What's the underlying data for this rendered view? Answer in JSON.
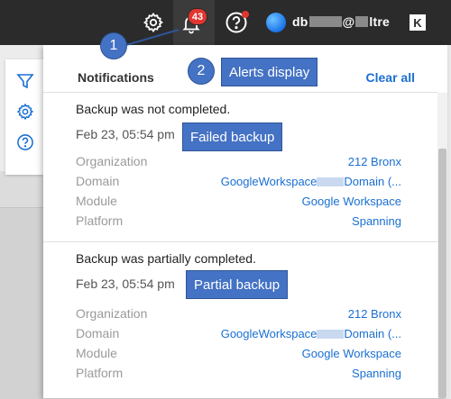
{
  "topbar": {
    "badge_count": "43",
    "user_email_start": "db",
    "user_email_mid": "@",
    "user_email_end": "ltre",
    "brand_mark": "K"
  },
  "annotations": {
    "marker_1": "1",
    "marker_2": "2",
    "alerts_display": "Alerts display",
    "failed_backup": "Failed backup",
    "partial_backup": "Partial backup"
  },
  "panel": {
    "title": "Notifications",
    "clear_all": "Clear all",
    "labels": {
      "organization": "Organization",
      "domain": "Domain",
      "module": "Module",
      "platform": "Platform"
    },
    "notifications": [
      {
        "title": "Backup was not completed.",
        "time": "Feb 23, 05:54 pm",
        "organization": "212 Bronx",
        "domain_start": "GoogleWorkspace",
        "domain_end": "Domain (...",
        "module": "Google Workspace",
        "platform": "Spanning"
      },
      {
        "title": "Backup was partially completed.",
        "time": "Feb 23, 05:54 pm",
        "organization": "212 Bronx",
        "domain_start": "GoogleWorkspace",
        "domain_end": "Domain (...",
        "module": "Google Workspace",
        "platform": "Spanning"
      }
    ]
  },
  "colors": {
    "topbar": "#2b2b2b",
    "badge": "#e2352f",
    "link": "#1a6fd1",
    "callout": "#4472c4"
  }
}
